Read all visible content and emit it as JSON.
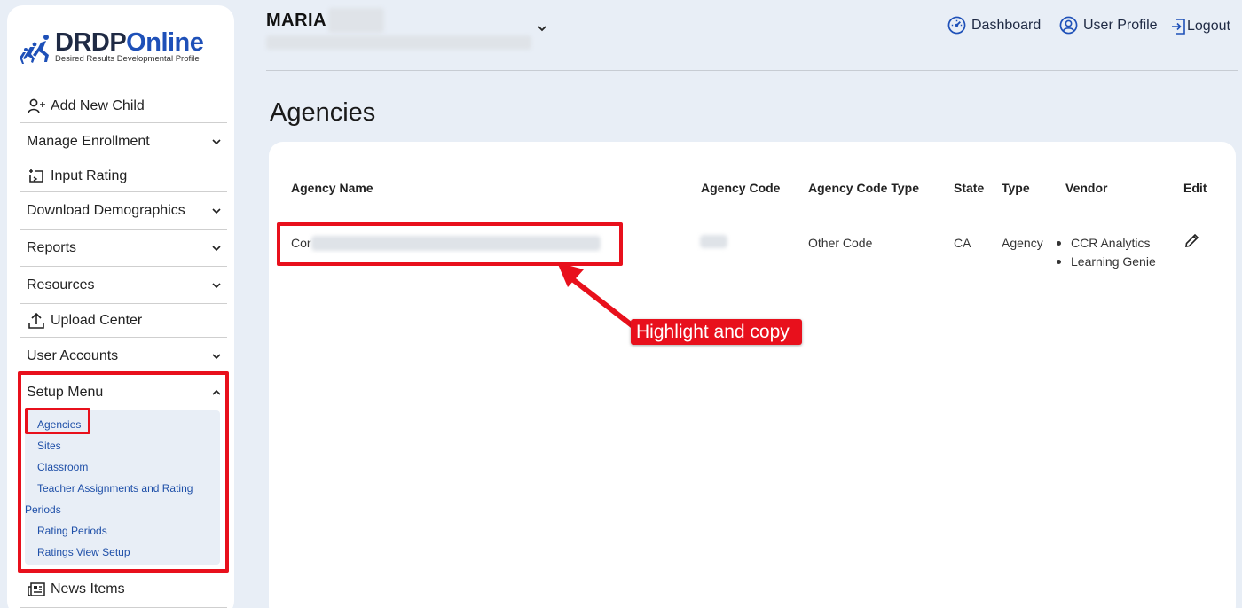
{
  "logo": {
    "title_a": "DRDP",
    "title_b": "Online",
    "subtitle": "Desired Results Developmental Profile"
  },
  "sidebar": {
    "items": [
      {
        "label": "Add New Child",
        "icon": "add-user-icon"
      },
      {
        "label": "Manage Enrollment",
        "icon": "chevron-down-icon"
      },
      {
        "label": "Input Rating",
        "icon": "input-rating-icon"
      },
      {
        "label": "Download Demographics",
        "icon": "chevron-down-icon"
      },
      {
        "label": "Reports",
        "icon": "chevron-down-icon"
      },
      {
        "label": "Resources",
        "icon": "chevron-down-icon"
      },
      {
        "label": "Upload Center",
        "icon": "upload-icon"
      },
      {
        "label": "User Accounts",
        "icon": "chevron-down-icon"
      },
      {
        "label": "Setup Menu",
        "icon": "chevron-up-icon"
      },
      {
        "label": "News Items",
        "icon": "newspaper-icon"
      }
    ],
    "setup_submenu": {
      "agencies": "Agencies",
      "sites": "Sites",
      "classroom": "Classroom",
      "teacher_line1": "Teacher Assignments and Rating",
      "teacher_line2": "Periods",
      "rating_periods": "Rating Periods",
      "ratings_view_setup": "Ratings View Setup"
    }
  },
  "header": {
    "user_name": "MARIA",
    "nav": {
      "dashboard": "Dashboard",
      "user_profile": "User Profile",
      "logout": "Logout"
    }
  },
  "page": {
    "title": "Agencies"
  },
  "table": {
    "columns": {
      "agency_name": "Agency Name",
      "agency_code": "Agency Code",
      "agency_code_type": "Agency Code Type",
      "state": "State",
      "type": "Type",
      "vendor": "Vendor",
      "edit": "Edit"
    },
    "rows": [
      {
        "agency_name_prefix": "Cor",
        "agency_code_type": "Other Code",
        "state": "CA",
        "type": "Agency",
        "vendors": [
          "CCR Analytics",
          "Learning Genie"
        ]
      }
    ]
  },
  "annotation": {
    "callout": "Highlight and copy",
    "color": "#e8101c"
  },
  "colors": {
    "background": "#e8eef6",
    "brand_blue": "#1e50b8",
    "link_blue": "#1e4fa8"
  }
}
